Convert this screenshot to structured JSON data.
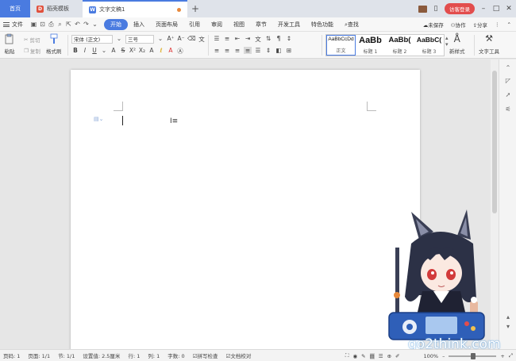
{
  "titlebar": {
    "tabs": [
      {
        "label": "首页"
      },
      {
        "label": "稻壳模板"
      },
      {
        "label": "文字文稿1"
      }
    ],
    "login_label": "访客登录",
    "new_tab": "+"
  },
  "menubar": {
    "file_label": "文件",
    "tabs": [
      "开始",
      "插入",
      "页面布局",
      "引用",
      "审阅",
      "视图",
      "章节",
      "开发工具",
      "特色功能"
    ],
    "search_label": "查找",
    "right": [
      "未保存",
      "协作",
      "分享"
    ]
  },
  "ribbon": {
    "paste": "粘贴",
    "cut": "剪切",
    "copy": "复制",
    "format_painter": "格式刷",
    "font_name": "宋体 (正文)",
    "font_size": "三号",
    "styles": [
      {
        "preview": "AaBbCcDd",
        "name": "正文"
      },
      {
        "preview": "AaBb",
        "name": "标题 1"
      },
      {
        "preview": "AaBb(",
        "name": "标题 2"
      },
      {
        "preview": "AaBbC(",
        "name": "标题 3"
      }
    ],
    "new_style": "新样式",
    "text_tools": "文字工具"
  },
  "status": {
    "page": "页码: 1",
    "pages": "页面: 1/1",
    "section": "节: 1/1",
    "setting": "设置值: 2.5厘米",
    "row": "行: 1",
    "col": "列: 1",
    "words": "字数: 0",
    "spell": "拼写检查",
    "proof": "文档校对",
    "zoom": "100%"
  },
  "watermark": "go2think.com",
  "colors": {
    "accent": "#4a7be0",
    "login": "#e24d4d",
    "modified_dot": "#e8893b"
  }
}
